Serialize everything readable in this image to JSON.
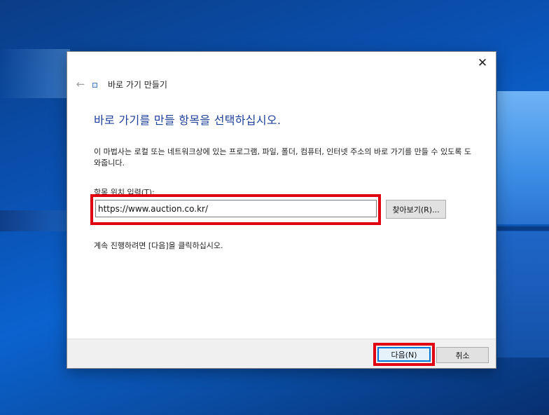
{
  "dialog": {
    "title": "바로 가기 만들기",
    "close_glyph": "✕",
    "back_glyph": "←"
  },
  "main": {
    "heading": "바로 가기를 만들 항목을 선택하십시오.",
    "description": "이 마법사는 로컬 또는 네트워크상에 있는 프로그램, 파일, 폴더, 컴퓨터, 인터넷 주소의 바로 가기를 만들 수 있도록 도와줍니다.",
    "location_label": "항목 위치 입력(T):",
    "location_value": "https://www.auction.co.kr/",
    "browse_label": "찾아보기(R)...",
    "continue_text": "계속 진행하려면 [다음]을 클릭하십시오."
  },
  "footer": {
    "next_label": "다음(N)",
    "cancel_label": "취소"
  },
  "colors": {
    "highlight": "#e00012",
    "heading": "#1e3f9a",
    "accent": "#0078d7"
  },
  "icons": {
    "back": "back-arrow-icon",
    "close": "close-icon",
    "title": "shortcut-icon"
  }
}
